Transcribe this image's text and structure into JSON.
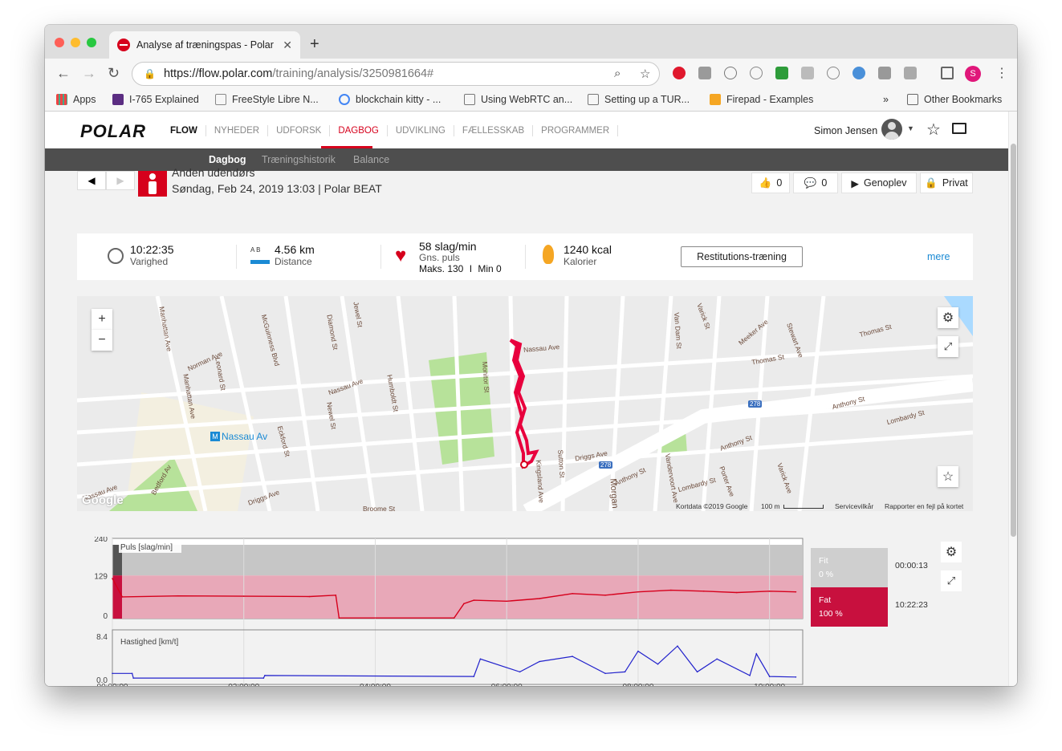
{
  "browser": {
    "tab_title": "Analyse af træningspas - Polar",
    "url_host": "https://flow.polar.com",
    "url_path": "/training/analysis/3250981664#",
    "profile_initial": "S"
  },
  "bookmarks": [
    {
      "label": "Apps"
    },
    {
      "label": "I-765 Explained"
    },
    {
      "label": "FreeStyle Libre N..."
    },
    {
      "label": "blockchain kitty - ..."
    },
    {
      "label": "Using WebRTC an..."
    },
    {
      "label": "Setting up a TUR..."
    },
    {
      "label": "Firepad - Examples"
    }
  ],
  "bookmarks_more": "»",
  "other_bookmarks": "Other Bookmarks",
  "site": {
    "logo": "POLAR",
    "nav": [
      "FLOW",
      "NYHEDER",
      "UDFORSK",
      "DAGBOG",
      "UDVIKLING",
      "FÆLLESSKAB",
      "PROGRAMMER"
    ],
    "active_nav": "DAGBOG",
    "user_name": "Simon Jensen",
    "subnav": [
      "Dagbog",
      "Træningshistorik",
      "Balance"
    ]
  },
  "session": {
    "sport": "Anden udendørs",
    "date_line": "Søndag, Feb 24, 2019 13:03 | Polar BEAT",
    "likes": "0",
    "comments": "0",
    "replay_label": "Genoplev",
    "privacy_label": "Privat"
  },
  "stats": {
    "duration": {
      "value": "10:22:35",
      "label": "Varighed"
    },
    "distance": {
      "value": "4.56 km",
      "label": "Distance",
      "icon_text": "A B"
    },
    "heart": {
      "value": "58 slag/min",
      "label": "Gns. puls",
      "max_label": "Maks. 130",
      "sep": "I",
      "min_label": "Min 0"
    },
    "calories": {
      "value": "1240 kcal",
      "label": "Kalorier"
    },
    "restitution_button": "Restitutions-træning",
    "more_link": "mere"
  },
  "map": {
    "streets": [
      "Manhattan Ave",
      "Manhattan Ave",
      "McGuinness Blvd",
      "Norman Ave",
      "Nassau Ave",
      "Nassau Ave",
      "Humboldt St",
      "Newel St",
      "Monitor St",
      "Eckford St",
      "Driggs Ave",
      "Driggs Ave",
      "Sutton St",
      "Morgan",
      "Anthony St",
      "Anthony St",
      "Anthony St",
      "Thomas St",
      "Thomas St",
      "Meeker Ave",
      "Stewart Ave",
      "Varick St",
      "Van Dam St",
      "Lombardy St",
      "Lombardy St",
      "Porter Ave",
      "Varick Ave",
      "Vandervoort Ave",
      "Bedford Av",
      "Jewel St",
      "Diamond St",
      "Leonard St",
      "Broome St",
      "Kingsland Ave",
      "Nassau Ave"
    ],
    "station": "Nassau Av",
    "highway_badge": "278",
    "google": "Google",
    "footer_data": "Kortdata ©2019 Google",
    "footer_scale": "100 m",
    "footer_terms": "Servicevilkår",
    "footer_report": "Rapporter en fejl på kortet"
  },
  "chart_data": [
    {
      "type": "area",
      "title": "Puls [slag/min]",
      "yticks": [
        "240",
        "129",
        "0"
      ],
      "xticks": [
        "00:00:00",
        "02:00:00",
        "04:00:00",
        "06:00:00",
        "08:00:00",
        "10:00:00"
      ],
      "ylim": [
        0,
        240
      ],
      "x_hours": [
        0,
        0.15,
        1,
        2,
        3,
        3.4,
        3.45,
        5.2,
        5.35,
        5.5,
        6.0,
        6.5,
        7.0,
        7.5,
        8.0,
        8.5,
        9.0,
        9.5,
        10.0,
        10.4
      ],
      "values": [
        120,
        65,
        68,
        67,
        66,
        70,
        2,
        2,
        45,
        55,
        52,
        60,
        75,
        70,
        80,
        85,
        82,
        78,
        82,
        80
      ],
      "zones": [
        {
          "name": "Fit",
          "percent": "0 %",
          "time": "00:00:13",
          "color": "#cfcfcf"
        },
        {
          "name": "Fat",
          "percent": "100 %",
          "time": "10:22:23",
          "color": "#c8103e"
        }
      ]
    },
    {
      "type": "line",
      "title": "Hastighed [km/t]",
      "yticks": [
        "8.4",
        "0.0"
      ],
      "ylim": [
        0,
        8.4
      ],
      "x_hours": [
        0,
        0.3,
        0.32,
        2.3,
        2.32,
        5.5,
        5.6,
        6.2,
        6.5,
        7.0,
        7.5,
        7.8,
        8.0,
        8.3,
        8.6,
        8.9,
        9.2,
        9.7,
        9.8,
        10.0,
        10.4
      ],
      "values": [
        1.2,
        1.2,
        0.3,
        0.3,
        0.8,
        0.6,
        4.0,
        1.5,
        3.5,
        4.5,
        1.2,
        1.5,
        5.5,
        3.0,
        6.5,
        1.5,
        4.0,
        0.8,
        5.0,
        0.6,
        0.5
      ]
    }
  ],
  "colors": {
    "accent": "#d6001c",
    "link": "#1a8ad4",
    "route": "#e8003d",
    "speed_line": "#2222cc"
  }
}
